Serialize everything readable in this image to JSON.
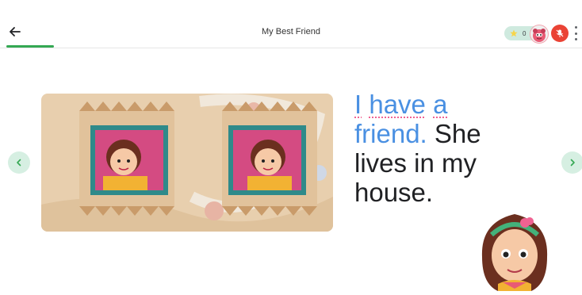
{
  "header": {
    "title": "My Best Friend",
    "stars_count": "0"
  },
  "story": {
    "highlighted_words": [
      "I",
      "have",
      "a",
      "friend."
    ],
    "remaining_text": " She lives in my house.",
    "highlight_color": "#4a90e2"
  },
  "colors": {
    "progress": "#34a853",
    "mic_button": "#ea4335",
    "nav_button_bg": "#d6efe2",
    "nav_arrow": "#34a853"
  },
  "icons": {
    "back": "back-arrow-icon",
    "star": "star-icon",
    "mic_off": "mic-off-icon",
    "more": "more-vert-icon",
    "prev": "chevron-left-icon",
    "next": "chevron-right-icon"
  },
  "reading_progress": 0.08
}
